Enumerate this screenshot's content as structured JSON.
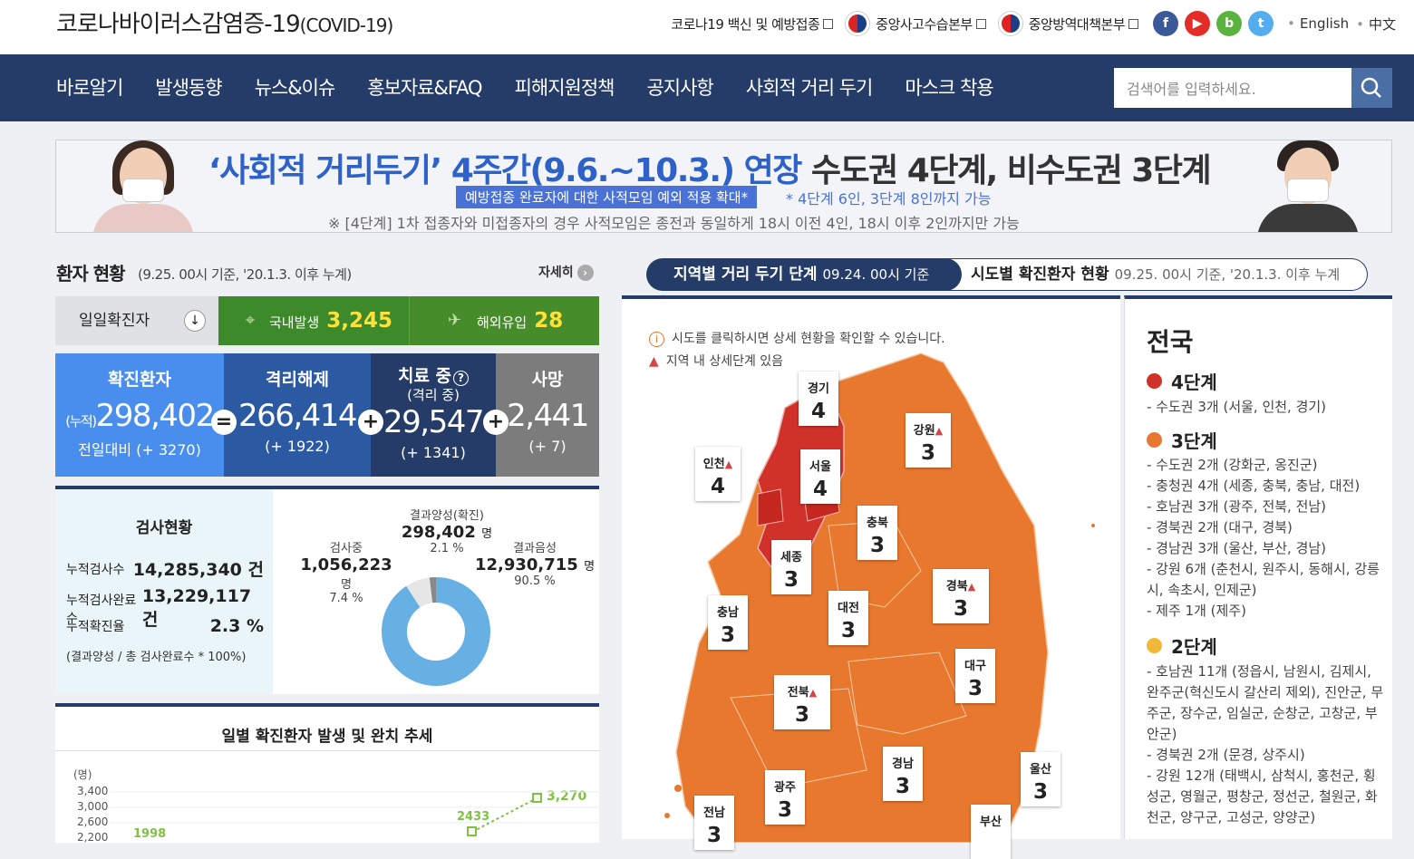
{
  "header": {
    "title": "코로나바이러스감염증-19",
    "title_suffix": "(COVID-19)",
    "links": [
      "코로나19 백신 및 예방접종",
      "중앙사고수습본부",
      "중앙방역대책본부"
    ],
    "lang": [
      "English",
      "中文"
    ]
  },
  "nav": [
    "바로알기",
    "발생동향",
    "뉴스&이슈",
    "홍보자료&FAQ",
    "피해지원정책",
    "공지사항",
    "사회적 거리 두기",
    "마스크 착용"
  ],
  "search": {
    "placeholder": "검색어를 입력하세요."
  },
  "banner": {
    "line1a": "‘사회적 거리두기’ 4주간(9.6.~10.3.) 연장",
    "line1b": "수도권 4단계, 비수도권 3단계",
    "pill": "예방접종 완료자에 대한 사적모임 예외 적용 확대*",
    "line2": "* 4단계 6인, 3단계 8인까지 가능",
    "line3": "※ [4단계] 1차 접종자와 미접종자의 경우 사적모임은 종전과 동일하게 18시 이전 4인, 18시 이후 2인까지만 가능"
  },
  "status": {
    "title": "환자 현황",
    "sub": "(9.25. 00시 기준, '20.1.3. 이후 누계)",
    "detail": "자세히",
    "daily_label": "일일확진자",
    "domestic_label": "국내발생",
    "domestic": "3,245",
    "abroad_label": "해외유입",
    "abroad": "28",
    "confirmed": {
      "label": "확진환자",
      "prefix": "(누적)",
      "value": "298,402",
      "delta": "전일대비 (+ 3270)"
    },
    "released": {
      "label": "격리해제",
      "value": "266,414",
      "delta": "(+ 1922)"
    },
    "treating": {
      "label": "치료 중",
      "sub": "(격리 중)",
      "value": "29,547",
      "delta": "(+ 1341)"
    },
    "death": {
      "label": "사망",
      "value": "2,441",
      "delta": "(+ 7)"
    }
  },
  "test": {
    "title": "검사현황",
    "rows": [
      {
        "label": "누적검사수",
        "value": "14,285,340 건"
      },
      {
        "label": "누적검사완료수",
        "value": "13,229,117 건"
      },
      {
        "label": "누적확진율",
        "value": "2.3 %"
      }
    ],
    "note": "(결과양성 / 총 검사완료수 * 100%)",
    "positive_label": "결과양성(확진)",
    "positive": "298,402",
    "positive_pct": "2.1 %",
    "testing_label": "검사중",
    "testing": "1,056,223",
    "testing_pct": "7.4 %",
    "negative_label": "결과음성",
    "negative": "12,930,715",
    "negative_pct": "90.5 %",
    "unit": "명"
  },
  "trend": {
    "title": "일별 확진환자 발생 및 완치 추세",
    "unit": "(명)",
    "ticks": [
      "3,400",
      "3,000",
      "2,600",
      "2,200"
    ],
    "labels": [
      "1998",
      "2433",
      "3,270"
    ]
  },
  "map": {
    "tab1": "지역별 거리 두기 단계",
    "tab1_date": "09.24. 00시 기준",
    "tab2": "시도별 확진환자 현황",
    "tab2_date": "09.25. 00시 기준, '20.1.3. 이후 누계",
    "info1": "시도를 클릭하시면 상세 현황을 확인할 수 있습니다.",
    "info2": "지역 내 상세단계 있음",
    "regions": [
      {
        "name": "경기",
        "level": "4"
      },
      {
        "name": "강원",
        "level": "3"
      },
      {
        "name": "인천",
        "level": "4"
      },
      {
        "name": "서울",
        "level": "4"
      },
      {
        "name": "충북",
        "level": "3"
      },
      {
        "name": "세종",
        "level": "3"
      },
      {
        "name": "경북",
        "level": "3"
      },
      {
        "name": "충남",
        "level": "3"
      },
      {
        "name": "대전",
        "level": "3"
      },
      {
        "name": "대구",
        "level": "3"
      },
      {
        "name": "전북",
        "level": "3"
      },
      {
        "name": "경남",
        "level": "3"
      },
      {
        "name": "울산",
        "level": "3"
      },
      {
        "name": "광주",
        "level": "3"
      },
      {
        "name": "전남",
        "level": "3"
      },
      {
        "name": "부산",
        "level": ""
      }
    ]
  },
  "legend": {
    "title": "전국",
    "l4": "4단계",
    "l4_desc": "- 수도권 3개 (서울, 인천, 경기)",
    "l3": "3단계",
    "l3_desc": [
      "- 수도권 2개 (강화군, 옹진군)",
      "- 충청권 4개 (세종, 충북, 충남, 대전)",
      "- 호남권 3개 (광주, 전북, 전남)",
      "- 경북권 2개 (대구, 경북)",
      "- 경남권 3개 (울산, 부산, 경남)",
      "- 강원 6개 (춘천시, 원주시, 동해시, 강릉시, 속초시, 인제군)",
      "- 제주 1개 (제주)"
    ],
    "l2": "2단계",
    "l2_desc": [
      "- 호남권 11개 (정읍시, 남원시, 김제시, 완주군(혁신도시 갈산리 제외), 진안군, 무주군, 장수군, 임실군, 순창군, 고창군, 부안군)",
      "- 경북권 2개 (문경, 상주시)",
      "- 강원 12개 (태백시, 삼척시, 홍천군, 횡성군, 영월군, 평창군, 정선군, 철원군, 화천군, 양구군, 고성군, 양양군)"
    ]
  },
  "colors": {
    "navy": "#253b68",
    "level4": "#d0322a",
    "level3": "#e8782e",
    "level2": "#f0b93a",
    "green": "#3d8a2b"
  }
}
